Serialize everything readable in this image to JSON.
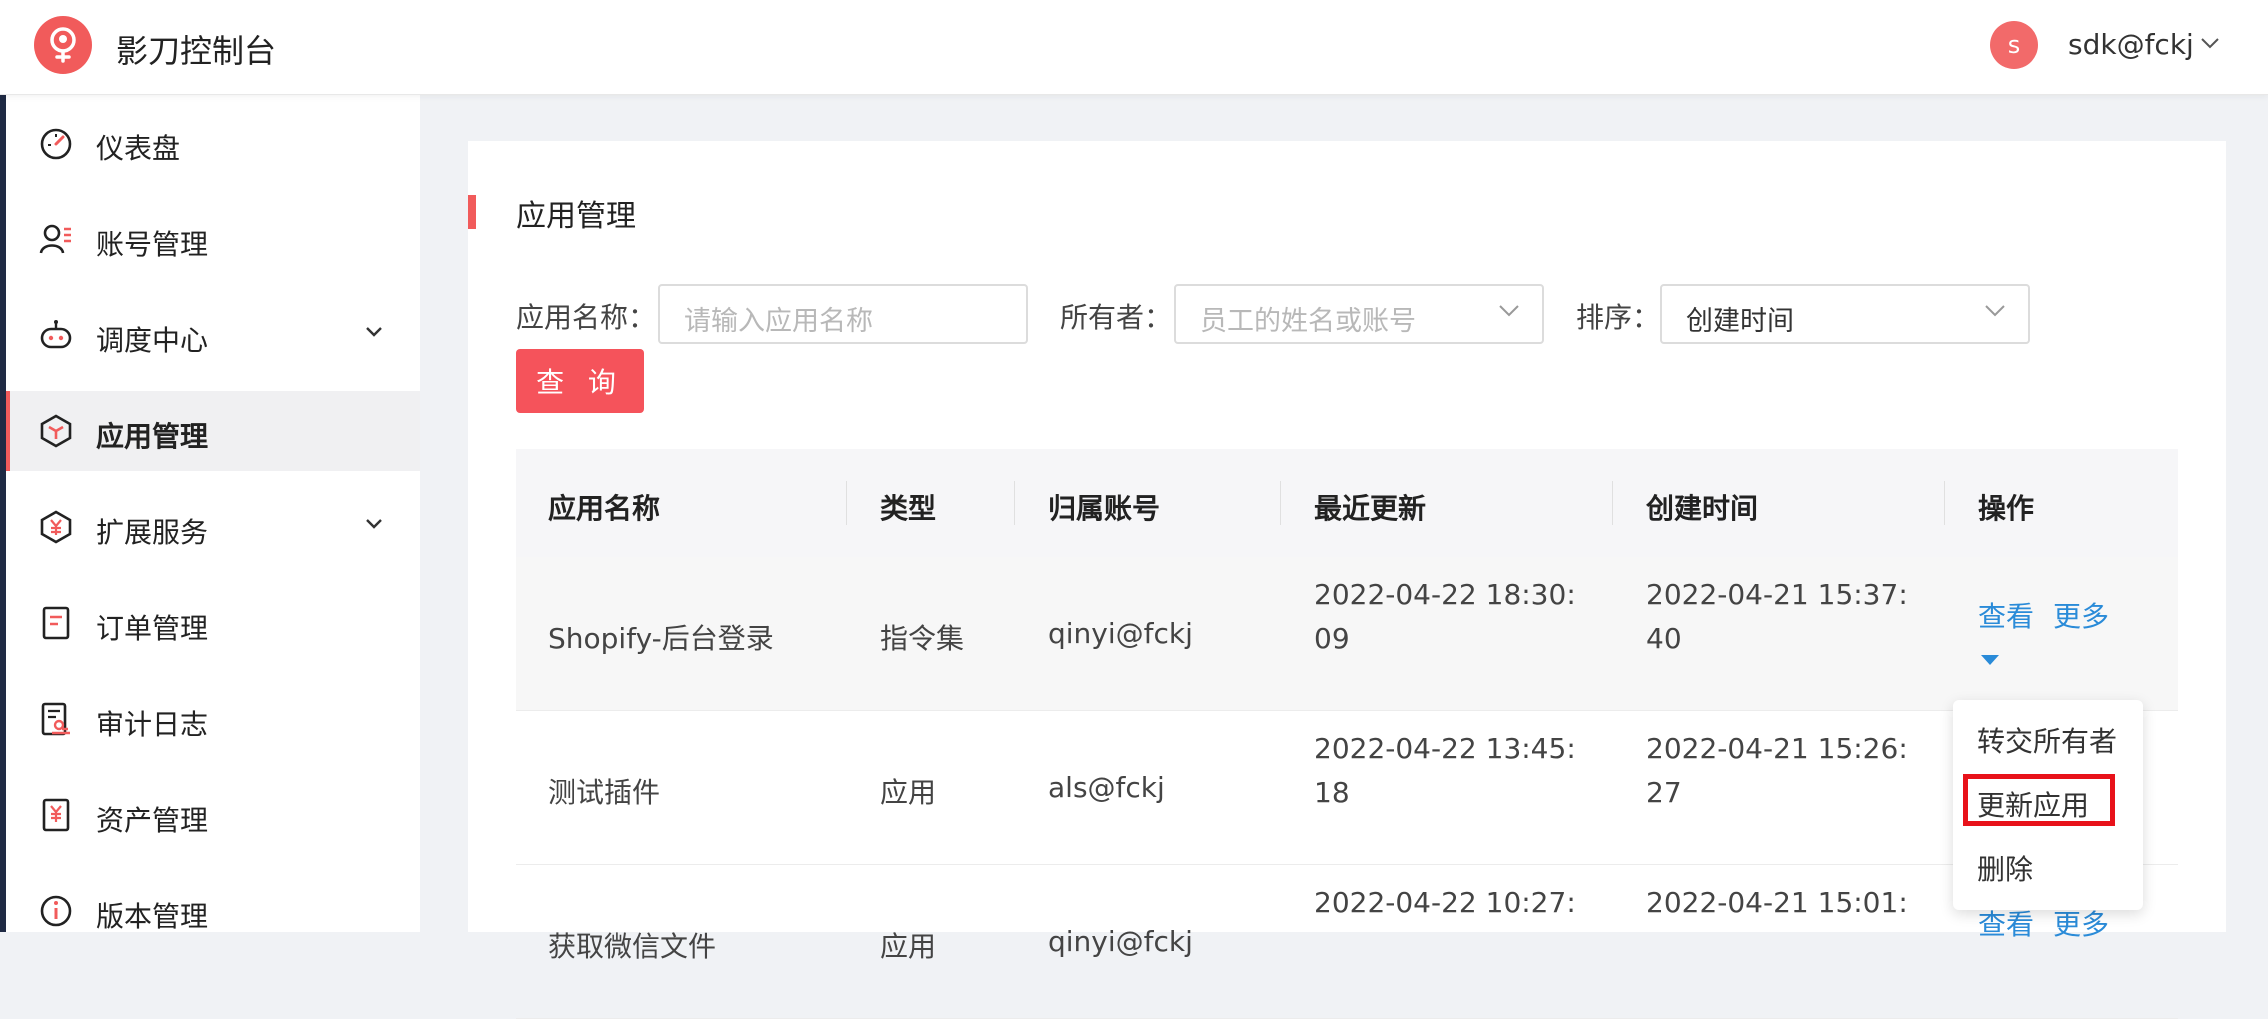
{
  "header": {
    "app_title": "影刀控制台",
    "avatar_letter": "s",
    "user": "sdk@fckj"
  },
  "sidebar": {
    "items": [
      {
        "label": "仪表盘",
        "icon": "dashboard-icon"
      },
      {
        "label": "账号管理",
        "icon": "user-list-icon"
      },
      {
        "label": "调度中心",
        "icon": "robot-icon",
        "expandable": true
      },
      {
        "label": "应用管理",
        "icon": "cube-icon",
        "active": true
      },
      {
        "label": "扩展服务",
        "icon": "yuan-shield-icon",
        "expandable": true
      },
      {
        "label": "订单管理",
        "icon": "order-icon"
      },
      {
        "label": "审计日志",
        "icon": "audit-icon"
      },
      {
        "label": "资产管理",
        "icon": "asset-icon"
      },
      {
        "label": "版本管理",
        "icon": "info-icon"
      }
    ]
  },
  "main": {
    "title": "应用管理",
    "filters": {
      "name_label": "应用名称：",
      "name_placeholder": "请输入应用名称",
      "owner_label": "所有者：",
      "owner_placeholder": "员工的姓名或账号",
      "sort_label": "排序：",
      "sort_value": "创建时间",
      "query_button": "查 询"
    },
    "table": {
      "headers": [
        "应用名称",
        "类型",
        "归属账号",
        "最近更新",
        "创建时间",
        "操作"
      ],
      "rows": [
        {
          "name": "Shopify-后台登录",
          "type": "指令集",
          "owner": "qinyi@fckj",
          "updated_1": "2022-04-22 18:30:",
          "updated_2": "09",
          "created_1": "2022-04-21 15:37:",
          "created_2": "40"
        },
        {
          "name": "测试插件",
          "type": "应用",
          "owner": "als@fckj",
          "updated_1": "2022-04-22 13:45:",
          "updated_2": "18",
          "created_1": "2022-04-21 15:26:",
          "created_2": "27"
        },
        {
          "name": "获取微信文件",
          "type": "应用",
          "owner": "qinyi@fckj",
          "updated_1": "2022-04-22 10:27:",
          "updated_2": "",
          "created_1": "2022-04-21 15:01:",
          "created_2": ""
        }
      ],
      "action_view": "查看",
      "action_more": "更多"
    },
    "dropdown": {
      "items": [
        "转交所有者",
        "更新应用",
        "删除"
      ]
    }
  },
  "colors": {
    "accent": "#f15b5b",
    "link": "#2a8bd8",
    "highlight": "#e8121a"
  }
}
